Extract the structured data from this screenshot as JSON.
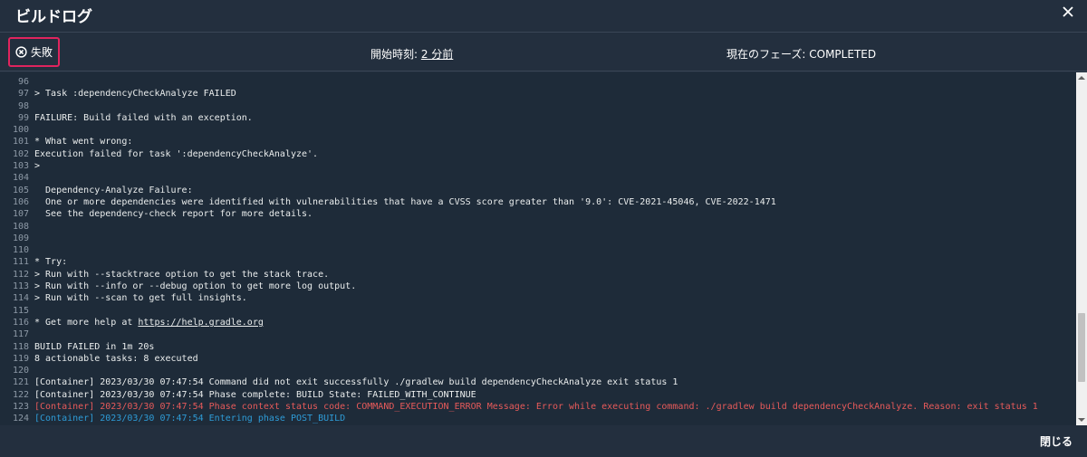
{
  "modal": {
    "title": "ビルドログ",
    "close_icon": "close-icon"
  },
  "status": {
    "badge_label": "失敗",
    "badge_icon": "x-circle-icon",
    "badge_color": "#e0245e",
    "start_label": "開始時刻: ",
    "start_value": "2 分前",
    "phase_label": "現在のフェーズ: COMPLETED"
  },
  "log": {
    "lines": [
      {
        "n": "96",
        "t": "",
        "k": ""
      },
      {
        "n": "97",
        "t": "> Task :dependencyCheckAnalyze FAILED",
        "k": ""
      },
      {
        "n": "98",
        "t": "",
        "k": ""
      },
      {
        "n": "99",
        "t": "FAILURE: Build failed with an exception.",
        "k": ""
      },
      {
        "n": "100",
        "t": "",
        "k": ""
      },
      {
        "n": "101",
        "t": "* What went wrong:",
        "k": ""
      },
      {
        "n": "102",
        "t": "Execution failed for task ':dependencyCheckAnalyze'.",
        "k": ""
      },
      {
        "n": "103",
        "t": ">",
        "k": ""
      },
      {
        "n": "104",
        "t": "",
        "k": ""
      },
      {
        "n": "105",
        "t": "  Dependency-Analyze Failure:",
        "k": ""
      },
      {
        "n": "106",
        "t": "  One or more dependencies were identified with vulnerabilities that have a CVSS score greater than '9.0': CVE-2021-45046, CVE-2022-1471",
        "k": ""
      },
      {
        "n": "107",
        "t": "  See the dependency-check report for more details.",
        "k": ""
      },
      {
        "n": "108",
        "t": "",
        "k": ""
      },
      {
        "n": "109",
        "t": "",
        "k": ""
      },
      {
        "n": "110",
        "t": "",
        "k": ""
      },
      {
        "n": "111",
        "t": "* Try:",
        "k": ""
      },
      {
        "n": "112",
        "t": "> Run with --stacktrace option to get the stack trace.",
        "k": ""
      },
      {
        "n": "113",
        "t": "> Run with --info or --debug option to get more log output.",
        "k": ""
      },
      {
        "n": "114",
        "t": "> Run with --scan to get full insights.",
        "k": ""
      },
      {
        "n": "115",
        "t": "",
        "k": ""
      },
      {
        "n": "116",
        "t": "* Get more help at ",
        "link": "https://help.gradle.org",
        "k": ""
      },
      {
        "n": "117",
        "t": "",
        "k": ""
      },
      {
        "n": "118",
        "t": "BUILD FAILED in 1m 20s",
        "k": ""
      },
      {
        "n": "119",
        "t": "8 actionable tasks: 8 executed",
        "k": ""
      },
      {
        "n": "120",
        "t": "",
        "k": ""
      },
      {
        "n": "121",
        "t": "[Container] 2023/03/30 07:47:54 Command did not exit successfully ./gradlew build dependencyCheckAnalyze exit status 1",
        "k": ""
      },
      {
        "n": "122",
        "t": "[Container] 2023/03/30 07:47:54 Phase complete: BUILD State: FAILED_WITH_CONTINUE",
        "k": ""
      },
      {
        "n": "123",
        "t": "[Container] 2023/03/30 07:47:54 Phase context status code: COMMAND_EXECUTION_ERROR Message: Error while executing command: ./gradlew build dependencyCheckAnalyze. Reason: exit status 1",
        "k": "err"
      },
      {
        "n": "124",
        "t": "[Container] 2023/03/30 07:47:54 Entering phase POST_BUILD",
        "k": "info"
      }
    ]
  },
  "footer": {
    "close_label": "閉じる"
  }
}
